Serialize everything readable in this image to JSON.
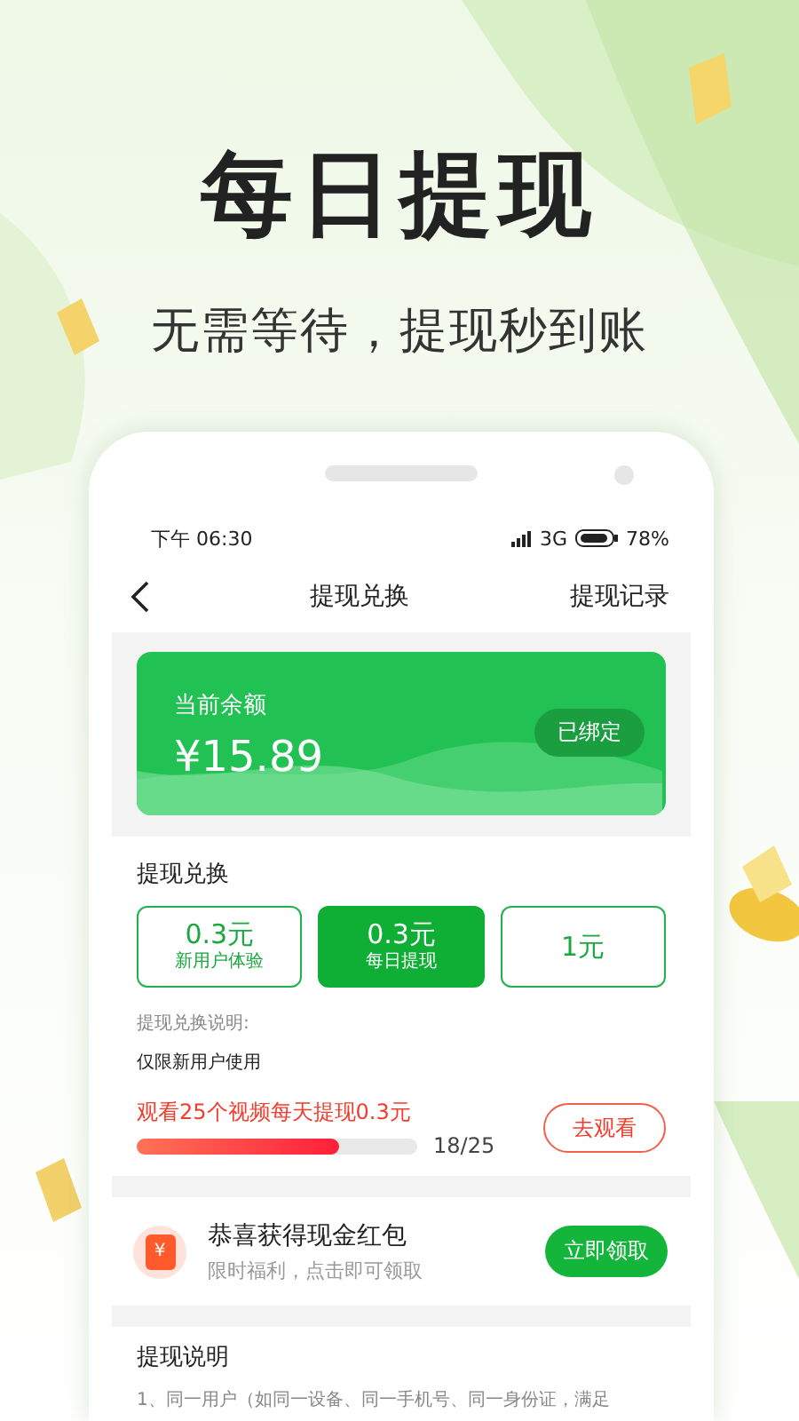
{
  "promo": {
    "title": "每日提现",
    "subtitle": "无需等待，提现秒到账"
  },
  "status_bar": {
    "time": "下午 06:30",
    "network": "3G",
    "battery": "78%"
  },
  "nav": {
    "title": "提现兑换",
    "action": "提现记录"
  },
  "balance": {
    "label": "当前余额",
    "amount": "¥15.89",
    "badge": "已绑定"
  },
  "exchange": {
    "heading": "提现兑换",
    "options": [
      {
        "amount": "0.3元",
        "caption": "新用户体验",
        "selected": false
      },
      {
        "amount": "0.3元",
        "caption": "每日提现",
        "selected": true
      },
      {
        "amount": "1元",
        "selected": false
      }
    ],
    "note_label": "提现兑换说明:",
    "note": "仅限新用户使用",
    "task": {
      "text": "观看25个视频每天提现0.3元",
      "level": 0.72,
      "count": "18/25",
      "button": "去观看"
    }
  },
  "reward": {
    "icon": "¥",
    "title": "恭喜获得现金红包",
    "subtitle": "限时福利，点击即可领取",
    "button": "立即领取"
  },
  "rules": {
    "heading": "提现说明",
    "lines": [
      "1、同一用户（如同一设备、同一手机号、同一身份证，满足"
    ]
  }
}
